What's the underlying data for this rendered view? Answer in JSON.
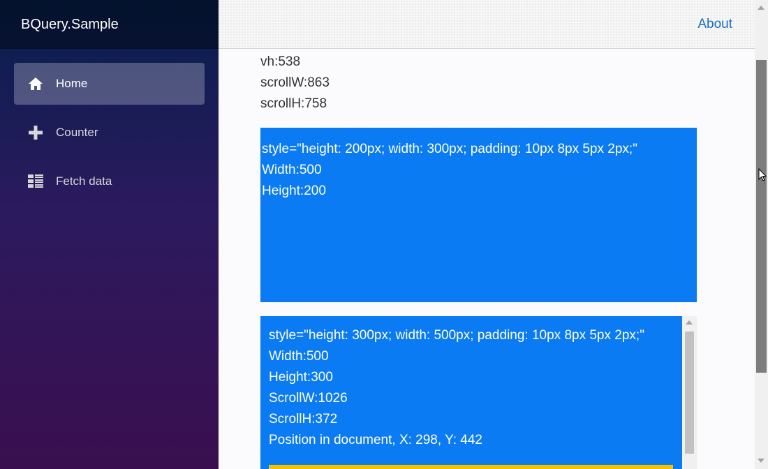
{
  "brand": {
    "title": "BQuery.Sample"
  },
  "nav": {
    "items": [
      {
        "label": "Home",
        "icon": "home-icon",
        "active": true
      },
      {
        "label": "Counter",
        "icon": "plus-icon",
        "active": false
      },
      {
        "label": "Fetch data",
        "icon": "list-icon",
        "active": false
      }
    ]
  },
  "topbar": {
    "about_label": "About"
  },
  "stats": {
    "vh": "vh:538",
    "scrollW": "scrollW:863",
    "scrollH": "scrollH:758"
  },
  "box1": {
    "style": "style=\"height: 200px; width: 300px; padding: 10px 8px 5px 2px;\"",
    "width": "Width:500",
    "height": "Height:200"
  },
  "box2": {
    "style": "style=\"height: 300px; width: 500px; padding: 10px 8px 5px 2px;\"",
    "width": "Width:500",
    "height": "Height:300",
    "scrollW": "ScrollW:1026",
    "scrollH": "ScrollH:372",
    "position": "Position in document, X: 298, Y: 442"
  },
  "colors": {
    "box_blue": "#0a7bf3",
    "link_blue": "#1b6ec2",
    "accent_yellow": "#f5c200"
  }
}
